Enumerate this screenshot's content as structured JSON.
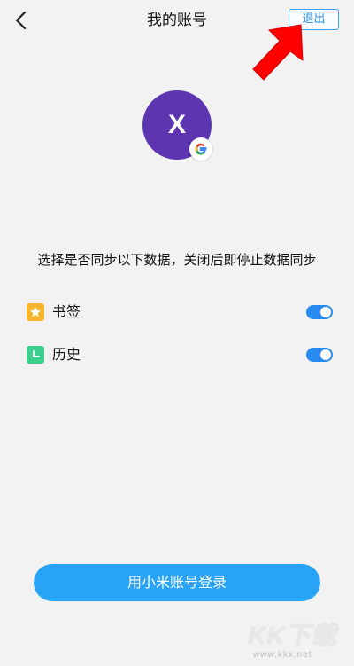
{
  "header": {
    "title": "我的账号",
    "logout_label": "退出"
  },
  "profile": {
    "avatar_letter": "X",
    "avatar_color": "#5e35b1",
    "badge": "google-icon"
  },
  "sync": {
    "description": "选择是否同步以下数据，关闭后即停止数据同步",
    "items": [
      {
        "label": "书签",
        "icon": "bookmark-star-icon",
        "icon_color": "#f7b52c",
        "enabled": true
      },
      {
        "label": "历史",
        "icon": "history-clock-icon",
        "icon_color": "#3ccf8e",
        "enabled": true
      }
    ]
  },
  "actions": {
    "login_label": "用小米账号登录"
  },
  "watermark": {
    "logo": "KK下载",
    "url": "www.kkx.net"
  },
  "colors": {
    "accent": "#29a3f5",
    "toggle_on": "#2a8cf2",
    "arrow": "#ff0000"
  }
}
